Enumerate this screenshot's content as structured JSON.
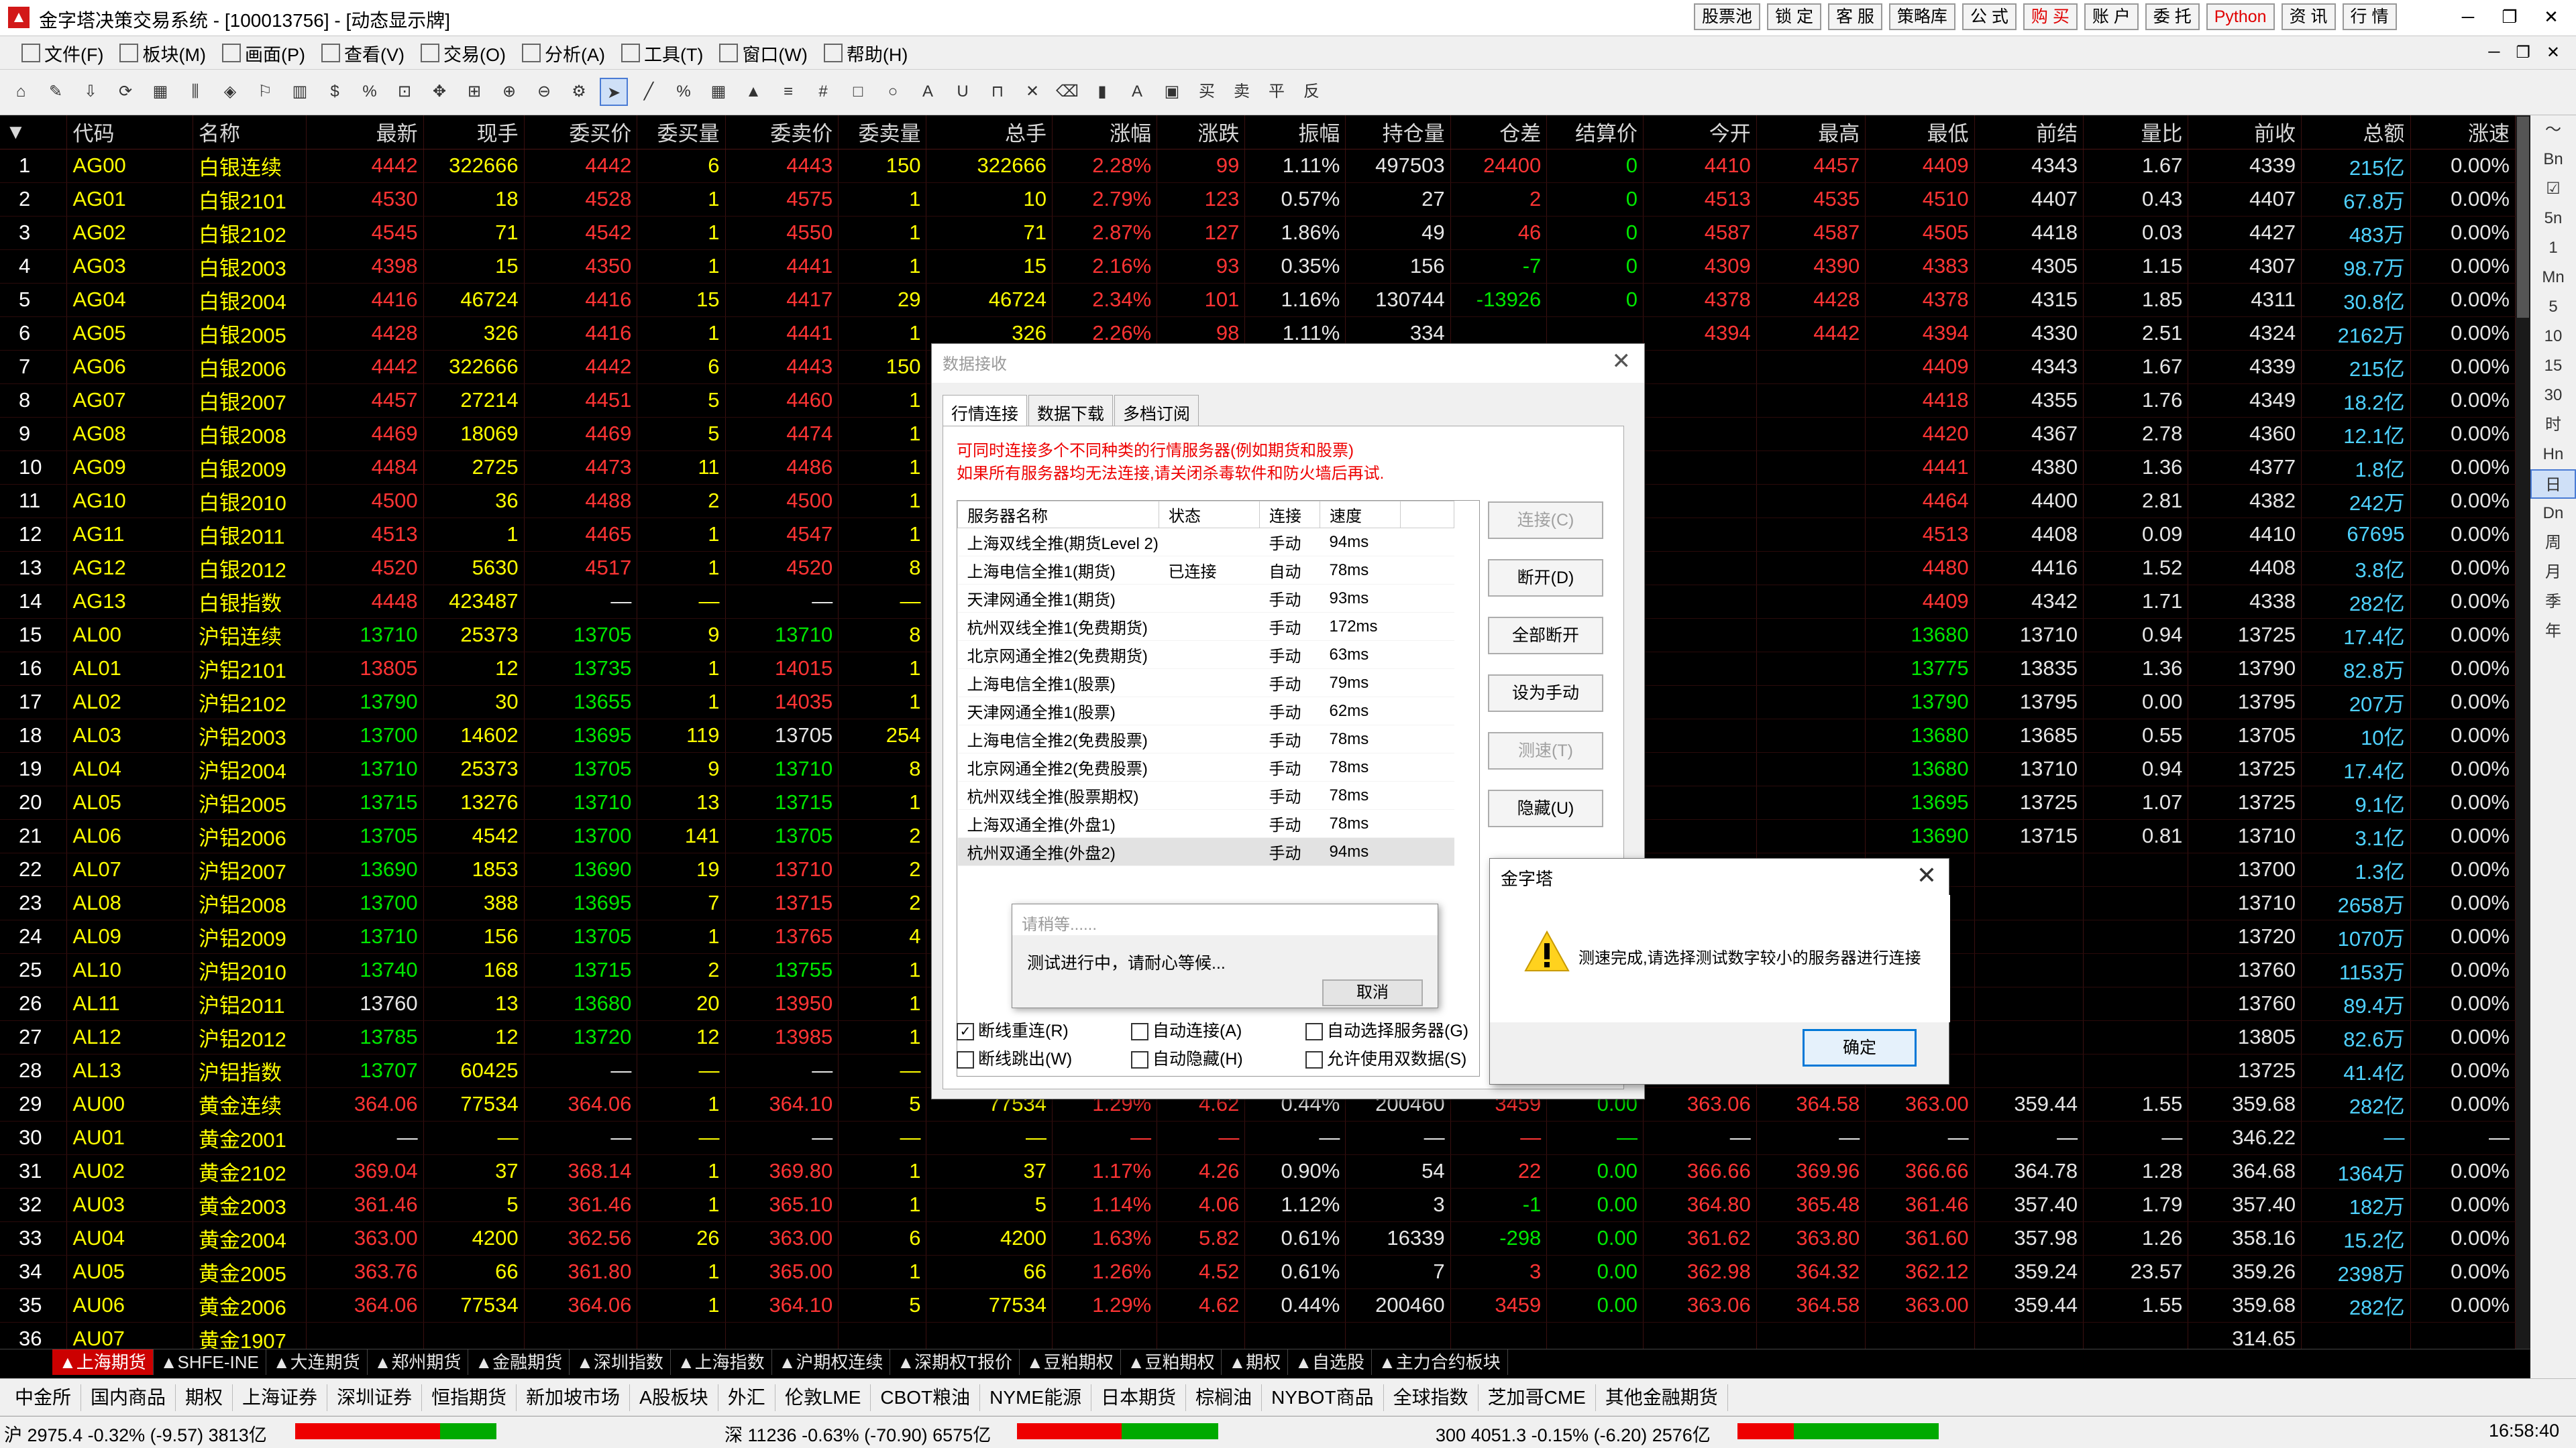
{
  "window": {
    "title": "金字塔决策交易系统 - [100013756] - [动态显示牌]",
    "icon": "pyramid-logo-icon",
    "top_buttons": [
      {
        "label": "股票池",
        "red": false
      },
      {
        "label": "锁 定",
        "red": false
      },
      {
        "label": "客 服",
        "red": false
      },
      {
        "label": "策略库",
        "red": false
      },
      {
        "label": "公 式",
        "red": false
      },
      {
        "label": "购 买",
        "red": true
      },
      {
        "label": "账 户",
        "red": false
      },
      {
        "label": "委 托",
        "red": false
      },
      {
        "label": "Python",
        "red": true
      },
      {
        "label": "资 讯",
        "red": false
      },
      {
        "label": "行 情",
        "red": false
      }
    ],
    "controls": {
      "minimize": "─",
      "restore": "❐",
      "close": "✕"
    }
  },
  "menu": {
    "items": [
      "文件(F)",
      "板块(M)",
      "画面(P)",
      "查看(V)",
      "交易(O)",
      "分析(A)",
      "工具(T)",
      "窗口(W)",
      "帮助(H)"
    ],
    "mdi_controls": [
      "─",
      "❐",
      "✕"
    ]
  },
  "toolbar": {
    "tools": [
      "⌂",
      "✎",
      "⇩",
      "⟳",
      "▦",
      "⫼",
      "◈",
      "⚐",
      "▥",
      "$",
      "%",
      "⊡",
      "✥",
      "⊞",
      "⊕",
      "⊖",
      "⚙",
      "➤",
      "╱",
      "%",
      "▦",
      "▲",
      "≡",
      "#",
      "□",
      "○",
      "A",
      "U",
      "⊓",
      "✕",
      "⌫",
      "▮",
      "A",
      "▣",
      "买",
      "卖",
      "平",
      "反"
    ]
  },
  "grid": {
    "columns": [
      "*",
      "代码",
      "名称",
      "最新",
      "现手",
      "委买价",
      "委买量",
      "委卖价",
      "委卖量",
      "总手",
      "涨幅",
      "涨跌",
      "振幅",
      "持仓量",
      "仓差",
      "结算价",
      "今开",
      "最高",
      "最低",
      "前结",
      "量比",
      "前收",
      "总额",
      "涨速"
    ],
    "sort_marker": "▼",
    "rows": [
      [
        "1",
        "AG00",
        "白银连续",
        "4442",
        "322666",
        "4442",
        "6",
        "4443",
        "150",
        "322666",
        "2.28%",
        "99",
        "1.11%",
        "497503",
        "24400",
        "0",
        "4410",
        "4457",
        "4409",
        "4343",
        "1.67",
        "4339",
        "215亿",
        "0.00%"
      ],
      [
        "2",
        "AG01",
        "白银2101",
        "4530",
        "18",
        "4528",
        "1",
        "4575",
        "1",
        "10",
        "2.79%",
        "123",
        "0.57%",
        "27",
        "2",
        "0",
        "4513",
        "4535",
        "4510",
        "4407",
        "0.43",
        "4407",
        "67.8万",
        "0.00%"
      ],
      [
        "3",
        "AG02",
        "白银2102",
        "4545",
        "71",
        "4542",
        "1",
        "4550",
        "1",
        "71",
        "2.87%",
        "127",
        "1.86%",
        "49",
        "46",
        "0",
        "4587",
        "4587",
        "4505",
        "4418",
        "0.03",
        "4427",
        "483万",
        "0.00%"
      ],
      [
        "4",
        "AG03",
        "白银2003",
        "4398",
        "15",
        "4350",
        "1",
        "4441",
        "1",
        "15",
        "2.16%",
        "93",
        "0.35%",
        "156",
        "-7",
        "0",
        "4309",
        "4390",
        "4383",
        "4305",
        "1.15",
        "4307",
        "98.7万",
        "0.00%"
      ],
      [
        "5",
        "AG04",
        "白银2004",
        "4416",
        "46724",
        "4416",
        "15",
        "4417",
        "29",
        "46724",
        "2.34%",
        "101",
        "1.16%",
        "130744",
        "-13926",
        "0",
        "4378",
        "4428",
        "4378",
        "4315",
        "1.85",
        "4311",
        "30.8亿",
        "0.00%"
      ],
      [
        "6",
        "AG05",
        "白银2005",
        "4428",
        "326",
        "4416",
        "1",
        "4441",
        "1",
        "326",
        "2.26%",
        "98",
        "1.11%",
        "334",
        "",
        "",
        "4394",
        "4442",
        "4394",
        "4330",
        "2.51",
        "4324",
        "2162万",
        "0.00%"
      ],
      [
        "7",
        "AG06",
        "白银2006",
        "4442",
        "322666",
        "4442",
        "6",
        "4443",
        "150",
        "",
        "",
        "",
        "",
        "",
        "",
        "",
        "",
        "",
        "4409",
        "4343",
        "1.67",
        "4339",
        "215亿",
        "0.00%"
      ],
      [
        "8",
        "AG07",
        "白银2007",
        "4457",
        "27214",
        "4451",
        "5",
        "4460",
        "1",
        "",
        "",
        "",
        "",
        "",
        "",
        "",
        "",
        "",
        "4418",
        "4355",
        "1.76",
        "4349",
        "18.2亿",
        "0.00%"
      ],
      [
        "9",
        "AG08",
        "白银2008",
        "4469",
        "18069",
        "4469",
        "5",
        "4474",
        "1",
        "",
        "",
        "",
        "",
        "",
        "",
        "",
        "",
        "",
        "4420",
        "4367",
        "2.78",
        "4360",
        "12.1亿",
        "0.00%"
      ],
      [
        "10",
        "AG09",
        "白银2009",
        "4484",
        "2725",
        "4473",
        "11",
        "4486",
        "1",
        "",
        "",
        "",
        "",
        "",
        "",
        "",
        "",
        "",
        "4441",
        "4380",
        "1.36",
        "4377",
        "1.8亿",
        "0.00%"
      ],
      [
        "11",
        "AG10",
        "白银2010",
        "4500",
        "36",
        "4488",
        "2",
        "4500",
        "1",
        "",
        "",
        "",
        "",
        "",
        "",
        "",
        "",
        "",
        "4464",
        "4400",
        "2.81",
        "4382",
        "242万",
        "0.00%"
      ],
      [
        "12",
        "AG11",
        "白银2011",
        "4513",
        "1",
        "4465",
        "1",
        "4547",
        "1",
        "",
        "",
        "",
        "",
        "",
        "",
        "",
        "",
        "",
        "4513",
        "4408",
        "0.09",
        "4410",
        "67695",
        "0.00%"
      ],
      [
        "13",
        "AG12",
        "白银2012",
        "4520",
        "5630",
        "4517",
        "1",
        "4520",
        "8",
        "",
        "",
        "",
        "",
        "",
        "",
        "",
        "",
        "",
        "4480",
        "4416",
        "1.52",
        "4408",
        "3.8亿",
        "0.00%"
      ],
      [
        "14",
        "AG13",
        "白银指数",
        "4448",
        "423487",
        "—",
        "—",
        "—",
        "—",
        "",
        "",
        "",
        "",
        "",
        "",
        "",
        "",
        "",
        "4409",
        "4342",
        "1.71",
        "4338",
        "282亿",
        "0.00%"
      ],
      [
        "15",
        "AL00",
        "沪铝连续",
        "13710",
        "25373",
        "13705",
        "9",
        "13710",
        "8",
        "",
        "",
        "",
        "",
        "",
        "",
        "",
        "",
        "",
        "13680",
        "13710",
        "0.94",
        "13725",
        "17.4亿",
        "0.00%"
      ],
      [
        "16",
        "AL01",
        "沪铝2101",
        "13805",
        "12",
        "13735",
        "1",
        "14015",
        "1",
        "",
        "",
        "",
        "",
        "",
        "",
        "",
        "",
        "",
        "13775",
        "13835",
        "1.36",
        "13790",
        "82.8万",
        "0.00%"
      ],
      [
        "17",
        "AL02",
        "沪铝2102",
        "13790",
        "30",
        "13655",
        "1",
        "14035",
        "1",
        "",
        "",
        "",
        "",
        "",
        "",
        "",
        "",
        "",
        "13790",
        "13795",
        "0.00",
        "13795",
        "207万",
        "0.00%"
      ],
      [
        "18",
        "AL03",
        "沪铝2003",
        "13700",
        "14602",
        "13695",
        "119",
        "13705",
        "254",
        "",
        "",
        "",
        "",
        "",
        "",
        "",
        "",
        "",
        "13680",
        "13685",
        "0.55",
        "13705",
        "10亿",
        "0.00%"
      ],
      [
        "19",
        "AL04",
        "沪铝2004",
        "13710",
        "25373",
        "13705",
        "9",
        "13710",
        "8",
        "",
        "",
        "",
        "",
        "",
        "",
        "",
        "",
        "",
        "13680",
        "13710",
        "0.94",
        "13725",
        "17.4亿",
        "0.00%"
      ],
      [
        "20",
        "AL05",
        "沪铝2005",
        "13715",
        "13276",
        "13710",
        "13",
        "13715",
        "1",
        "",
        "",
        "",
        "",
        "",
        "",
        "",
        "",
        "",
        "13695",
        "13725",
        "1.07",
        "13725",
        "9.1亿",
        "0.00%"
      ],
      [
        "21",
        "AL06",
        "沪铝2006",
        "13705",
        "4542",
        "13700",
        "141",
        "13705",
        "2",
        "",
        "",
        "",
        "",
        "",
        "",
        "",
        "",
        "",
        "13690",
        "13715",
        "0.81",
        "13710",
        "3.1亿",
        "0.00%"
      ],
      [
        "22",
        "AL07",
        "沪铝2007",
        "13690",
        "1853",
        "13690",
        "19",
        "13710",
        "2",
        "",
        "",
        "",
        "",
        "",
        "",
        "",
        "",
        "",
        "",
        "",
        "",
        "13700",
        "1.3亿",
        "0.00%"
      ],
      [
        "23",
        "AL08",
        "沪铝2008",
        "13700",
        "388",
        "13695",
        "7",
        "13715",
        "2",
        "",
        "",
        "",
        "",
        "",
        "",
        "",
        "",
        "",
        "",
        "",
        "",
        "13710",
        "2658万",
        "0.00%"
      ],
      [
        "24",
        "AL09",
        "沪铝2009",
        "13710",
        "156",
        "13705",
        "1",
        "13765",
        "4",
        "",
        "",
        "",
        "",
        "",
        "",
        "",
        "",
        "",
        "",
        "",
        "",
        "13720",
        "1070万",
        "0.00%"
      ],
      [
        "25",
        "AL10",
        "沪铝2010",
        "13740",
        "168",
        "13715",
        "2",
        "13755",
        "1",
        "",
        "",
        "",
        "",
        "",
        "",
        "",
        "",
        "",
        "",
        "",
        "",
        "13760",
        "1153万",
        "0.00%"
      ],
      [
        "26",
        "AL11",
        "沪铝2011",
        "13760",
        "13",
        "13680",
        "20",
        "13950",
        "1",
        "",
        "",
        "",
        "",
        "",
        "",
        "",
        "",
        "",
        "",
        "",
        "",
        "13760",
        "89.4万",
        "0.00%"
      ],
      [
        "27",
        "AL12",
        "沪铝2012",
        "13785",
        "12",
        "13720",
        "12",
        "13985",
        "1",
        "",
        "",
        "",
        "",
        "",
        "",
        "",
        "",
        "",
        "",
        "",
        "",
        "13805",
        "82.6万",
        "0.00%"
      ],
      [
        "28",
        "AL13",
        "沪铝指数",
        "13707",
        "60425",
        "—",
        "—",
        "—",
        "—",
        "",
        "",
        "",
        "",
        "",
        "",
        "",
        "",
        "",
        "",
        "",
        "",
        "13725",
        "41.4亿",
        "0.00%"
      ],
      [
        "29",
        "AU00",
        "黄金连续",
        "364.06",
        "77534",
        "364.06",
        "1",
        "364.10",
        "5",
        "77534",
        "1.29%",
        "4.62",
        "0.44%",
        "200460",
        "3459",
        "0.00",
        "363.06",
        "364.58",
        "363.00",
        "359.44",
        "1.55",
        "359.68",
        "282亿",
        "0.00%"
      ],
      [
        "30",
        "AU01",
        "黄金2001",
        "—",
        "—",
        "—",
        "—",
        "—",
        "—",
        "—",
        "—",
        "—",
        "—",
        "—",
        "—",
        "—",
        "—",
        "—",
        "—",
        "—",
        "—",
        "346.22",
        "—",
        "—"
      ],
      [
        "31",
        "AU02",
        "黄金2102",
        "369.04",
        "37",
        "368.14",
        "1",
        "369.80",
        "1",
        "37",
        "1.17%",
        "4.26",
        "0.90%",
        "54",
        "22",
        "0.00",
        "366.66",
        "369.96",
        "366.66",
        "364.78",
        "1.28",
        "364.68",
        "1364万",
        "0.00%"
      ],
      [
        "32",
        "AU03",
        "黄金2003",
        "361.46",
        "5",
        "361.46",
        "1",
        "365.10",
        "1",
        "5",
        "1.14%",
        "4.06",
        "1.12%",
        "3",
        "-1",
        "0.00",
        "364.80",
        "365.48",
        "361.46",
        "357.40",
        "1.79",
        "357.40",
        "182万",
        "0.00%"
      ],
      [
        "33",
        "AU04",
        "黄金2004",
        "363.00",
        "4200",
        "362.56",
        "26",
        "363.00",
        "6",
        "4200",
        "1.63%",
        "5.82",
        "0.61%",
        "16339",
        "-298",
        "0.00",
        "361.62",
        "363.80",
        "361.60",
        "357.98",
        "1.26",
        "358.16",
        "15.2亿",
        "0.00%"
      ],
      [
        "34",
        "AU05",
        "黄金2005",
        "363.76",
        "66",
        "361.80",
        "1",
        "365.00",
        "1",
        "66",
        "1.26%",
        "4.52",
        "0.61%",
        "7",
        "3",
        "0.00",
        "362.98",
        "364.32",
        "362.12",
        "359.24",
        "23.57",
        "359.26",
        "2398万",
        "0.00%"
      ],
      [
        "35",
        "AU06",
        "黄金2006",
        "364.06",
        "77534",
        "364.06",
        "1",
        "364.10",
        "5",
        "77534",
        "1.29%",
        "4.62",
        "0.44%",
        "200460",
        "3459",
        "0.00",
        "363.06",
        "364.58",
        "363.00",
        "359.44",
        "1.55",
        "359.68",
        "282亿",
        "0.00%"
      ],
      [
        "36",
        "AU07",
        "黄金1907",
        "",
        "",
        "",
        "",
        "",
        "",
        "",
        "",
        "",
        "",
        "",
        "",
        "",
        "",
        "",
        "",
        "",
        "",
        "314.65",
        "",
        ""
      ]
    ]
  },
  "right_sidebar": [
    "〜",
    "Bn",
    "☑",
    "5n",
    "1",
    "Mn",
    "5",
    "10",
    "15",
    "30",
    "时",
    "Hn",
    "日",
    "Dn",
    "周",
    "月",
    "季",
    "年"
  ],
  "sheet_tabs": [
    "上海期货",
    "SHFE-INE",
    "大连期货",
    "郑州期货",
    "金融期货",
    "深圳指数",
    "上海指数",
    "沪期权连续",
    "深期权T报价",
    "豆粕期权",
    "豆粕期权",
    "期权",
    "自选股",
    "主力合约板块"
  ],
  "category_bar": [
    "中金所",
    "国内商品",
    "期权",
    "上海证券",
    "深圳证券",
    "恒指期货",
    "新加坡市场",
    "A股板块",
    "外汇",
    "伦敦LME",
    "CBOT粮油",
    "NYME能源",
    "日本期货",
    "棕榈油",
    "NYBOT商品",
    "全球指数",
    "芝加哥CME",
    "其他金融期货"
  ],
  "status_bar": {
    "sh": "沪 2975.4 -0.32% (-9.57) 3813亿",
    "sz": "深 11236 -0.63% (-70.90) 6575亿",
    "h300": "300 4051.3 -0.15% (-6.20) 2576亿",
    "time": "16:58:40",
    "bars": [
      {
        "red": 0.72,
        "green": 0.28
      },
      {
        "red": 0.52,
        "green": 0.48
      },
      {
        "red": 0.28,
        "green": 0.72
      }
    ]
  },
  "data_dialog": {
    "title": "数据接收",
    "tabs": [
      "行情连接",
      "数据下载",
      "多档订阅"
    ],
    "note_line1": "可同时连接多个不同种类的行情服务器(例如期货和股票)",
    "note_line2": "如果所有服务器均无法连接,请关闭杀毒软件和防火墙后再试.",
    "list_headers": [
      "服务器名称",
      "状态",
      "连接",
      "速度"
    ],
    "servers": [
      [
        "上海双线全推(期货Level 2)",
        "",
        "手动",
        "94ms"
      ],
      [
        "上海电信全推1(期货)",
        "已连接",
        "自动",
        "78ms"
      ],
      [
        "天津网通全推1(期货)",
        "",
        "手动",
        "93ms"
      ],
      [
        "杭州双线全推1(免费期货)",
        "",
        "手动",
        "172ms"
      ],
      [
        "北京网通全推2(免费期货)",
        "",
        "手动",
        "63ms"
      ],
      [
        "上海电信全推1(股票)",
        "",
        "手动",
        "79ms"
      ],
      [
        "天津网通全推1(股票)",
        "",
        "手动",
        "62ms"
      ],
      [
        "上海电信全推2(免费股票)",
        "",
        "手动",
        "78ms"
      ],
      [
        "北京网通全推2(免费股票)",
        "",
        "手动",
        "78ms"
      ],
      [
        "杭州双线全推(股票期权)",
        "",
        "手动",
        "78ms"
      ],
      [
        "上海双通全推(外盘1)",
        "",
        "手动",
        "78ms"
      ],
      [
        "杭州双通全推(外盘2)",
        "",
        "手动",
        "94ms"
      ]
    ],
    "buttons": [
      {
        "label": "连接(C)",
        "disabled": true
      },
      {
        "label": "断开(D)",
        "disabled": false
      },
      {
        "label": "全部断开",
        "disabled": false
      },
      {
        "label": "设为手动",
        "disabled": false
      },
      {
        "label": "测速(T)",
        "disabled": true
      },
      {
        "label": "隐藏(U)",
        "disabled": false
      }
    ],
    "checks": [
      {
        "label": "断线重连(R)",
        "checked": true
      },
      {
        "label": "自动连接(A)",
        "checked": false
      },
      {
        "label": "自动选择服务器(G)",
        "checked": false
      },
      {
        "label": "断线跳出(W)",
        "checked": false
      },
      {
        "label": "自动隐藏(H)",
        "checked": false
      },
      {
        "label": "允许使用双数据(S)",
        "checked": false
      }
    ]
  },
  "wait_dialog": {
    "title": "请稍等......",
    "message": "测试进行中，请耐心等候...",
    "cancel": "取消"
  },
  "alert_dialog": {
    "title": "金字塔",
    "message": "测速完成,请选择测试数字较小的服务器进行连接",
    "ok": "确定"
  }
}
